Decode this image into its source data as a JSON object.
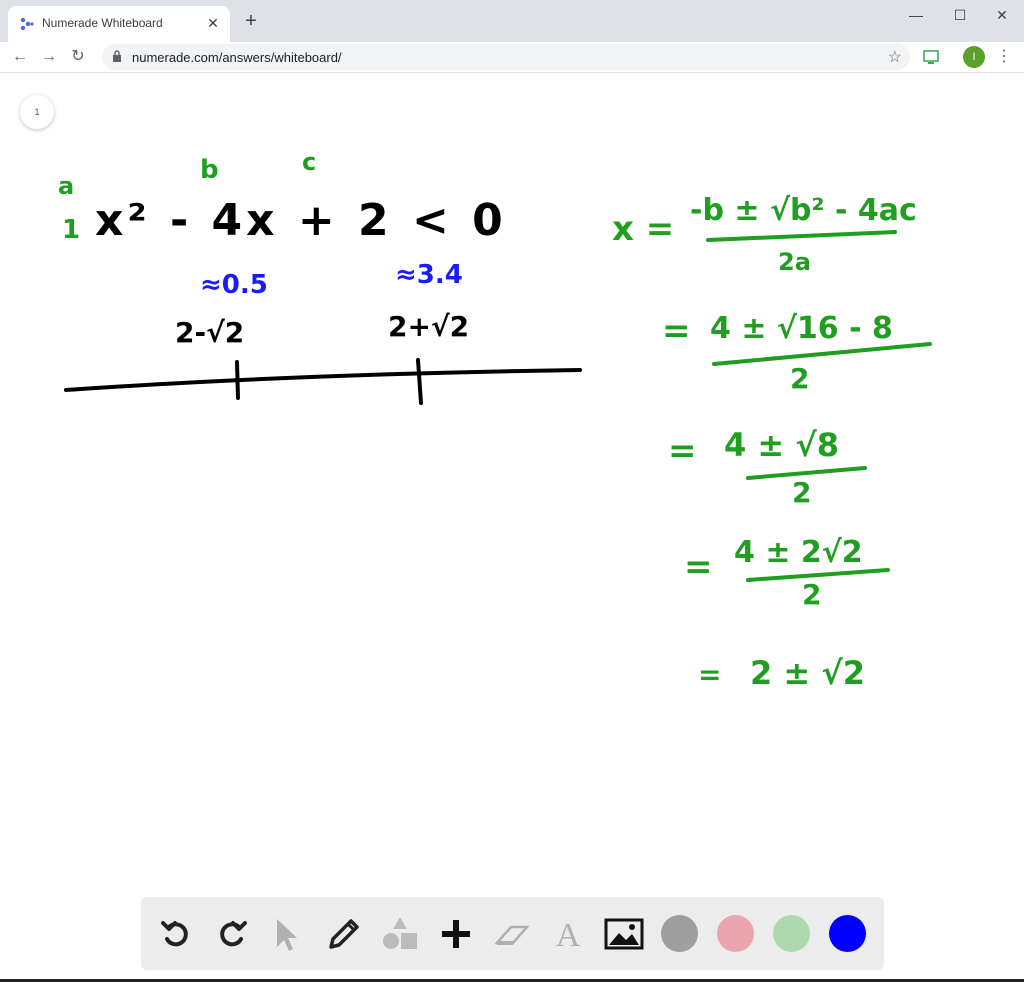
{
  "browser": {
    "tab_title": "Numerade Whiteboard",
    "tab_close": "✕",
    "new_tab": "+",
    "url": "numerade.com/answers/whiteboard/",
    "profile_initial": "I",
    "window_minimize": "—",
    "window_maximize": "☐",
    "window_close": "✕"
  },
  "whiteboard": {
    "page_number": "1",
    "coefficients": {
      "a": "a",
      "a_value": "1",
      "b": "b",
      "c": "c"
    },
    "inequality": "x² - 4x + 2 < 0",
    "root_approx_1": "≈0.5",
    "root_approx_2": "≈3.4",
    "root_1": "2-√2",
    "root_2": "2+√2",
    "steps": [
      {
        "lhs": "x =",
        "num": "-b ± √b² - 4ac",
        "den": "2a"
      },
      {
        "lhs": "=",
        "num": "4 ± √16 - 8",
        "den": "2"
      },
      {
        "lhs": "=",
        "num": "4 ± √8",
        "den": "2"
      },
      {
        "lhs": "=",
        "num": "4 ± 2√2",
        "den": "2"
      },
      {
        "lhs": "=",
        "num": "2 ± √2",
        "den": ""
      }
    ]
  },
  "toolbar": {
    "tools": [
      "undo-icon",
      "redo-icon",
      "pointer-icon",
      "pen-icon",
      "shapes-icon",
      "plus-icon",
      "eraser-icon",
      "text-icon",
      "image-icon"
    ],
    "text_tool_glyph": "A",
    "colors": [
      "#9e9e9e",
      "#e8a6ac",
      "#acd9ae",
      "#0000ff"
    ]
  },
  "colors": {
    "ink_black": "#000000",
    "ink_green": "#1f9e1f",
    "ink_blue": "#1a1aff"
  }
}
